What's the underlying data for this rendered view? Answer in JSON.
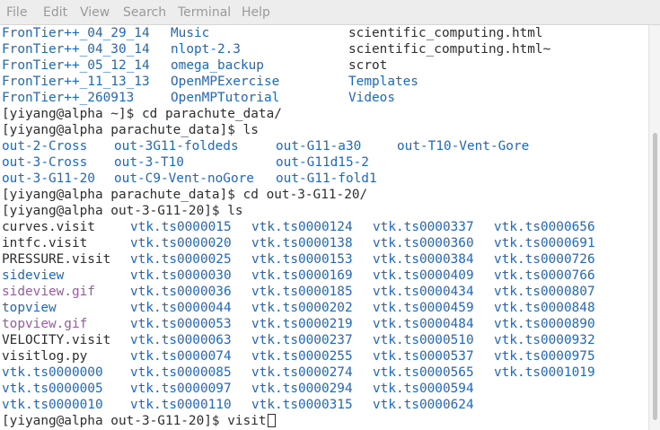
{
  "menubar": {
    "items": [
      "File",
      "Edit",
      "View",
      "Search",
      "Terminal",
      "Help"
    ]
  },
  "terminal": {
    "listing1": [
      [
        "FronTier++_04_29_14",
        "Music",
        "scientific_computing.html"
      ],
      [
        "FronTier++_04_30_14",
        "nlopt-2.3",
        "scientific_computing.html~"
      ],
      [
        "FronTier++_05_12_14",
        "omega_backup",
        "scrot"
      ],
      [
        "FronTier++_11_13_13",
        "OpenMPExercise",
        "Templates"
      ],
      [
        "FronTier++_260913",
        "OpenMPTutorial",
        "Videos"
      ]
    ],
    "cmd1": "[yiyang@alpha ~]$ cd parachute_data/",
    "cmd2": "[yiyang@alpha parachute_data]$ ls",
    "listing2": [
      [
        "out-2-Cross",
        "out-3G11-foldeds",
        "out-G11-a30",
        "out-T10-Vent-Gore"
      ],
      [
        "out-3-Cross",
        "out-3-T10",
        "out-G11d15-2",
        ""
      ],
      [
        "out-3-G11-20",
        "out-C9-Vent-noGore",
        "out-G11-fold1",
        ""
      ]
    ],
    "cmd3": "[yiyang@alpha parachute_data]$ cd out-3-G11-20/",
    "cmd4": "[yiyang@alpha out-3-G11-20]$ ls",
    "listing3": [
      [
        "curves.visit",
        "vtk.ts0000015",
        "vtk.ts0000124",
        "vtk.ts0000337",
        "vtk.ts0000656"
      ],
      [
        "intfc.visit",
        "vtk.ts0000020",
        "vtk.ts0000138",
        "vtk.ts0000360",
        "vtk.ts0000691"
      ],
      [
        "PRESSURE.visit",
        "vtk.ts0000025",
        "vtk.ts0000153",
        "vtk.ts0000384",
        "vtk.ts0000726"
      ],
      [
        "sideview",
        "vtk.ts0000030",
        "vtk.ts0000169",
        "vtk.ts0000409",
        "vtk.ts0000766"
      ],
      [
        "sideview.gif",
        "vtk.ts0000036",
        "vtk.ts0000185",
        "vtk.ts0000434",
        "vtk.ts0000807"
      ],
      [
        "topview",
        "vtk.ts0000044",
        "vtk.ts0000202",
        "vtk.ts0000459",
        "vtk.ts0000848"
      ],
      [
        "topview.gif",
        "vtk.ts0000053",
        "vtk.ts0000219",
        "vtk.ts0000484",
        "vtk.ts0000890"
      ],
      [
        "VELOCITY.visit",
        "vtk.ts0000063",
        "vtk.ts0000237",
        "vtk.ts0000510",
        "vtk.ts0000932"
      ],
      [
        "visitlog.py",
        "vtk.ts0000074",
        "vtk.ts0000255",
        "vtk.ts0000537",
        "vtk.ts0000975"
      ],
      [
        "vtk.ts0000000",
        "vtk.ts0000085",
        "vtk.ts0000274",
        "vtk.ts0000565",
        "vtk.ts0001019"
      ],
      [
        "vtk.ts0000005",
        "vtk.ts0000097",
        "vtk.ts0000294",
        "vtk.ts0000594",
        ""
      ],
      [
        "vtk.ts0000010",
        "vtk.ts0000110",
        "vtk.ts0000315",
        "vtk.ts0000624",
        ""
      ]
    ],
    "prompt": "[yiyang@alpha out-3-G11-20]$ ",
    "current_input": "visit"
  },
  "colors": {
    "directory": "#1f68c5",
    "image_file": "#9b59a6",
    "regular_file": "#2e2e2e",
    "background": "#ffffff"
  }
}
